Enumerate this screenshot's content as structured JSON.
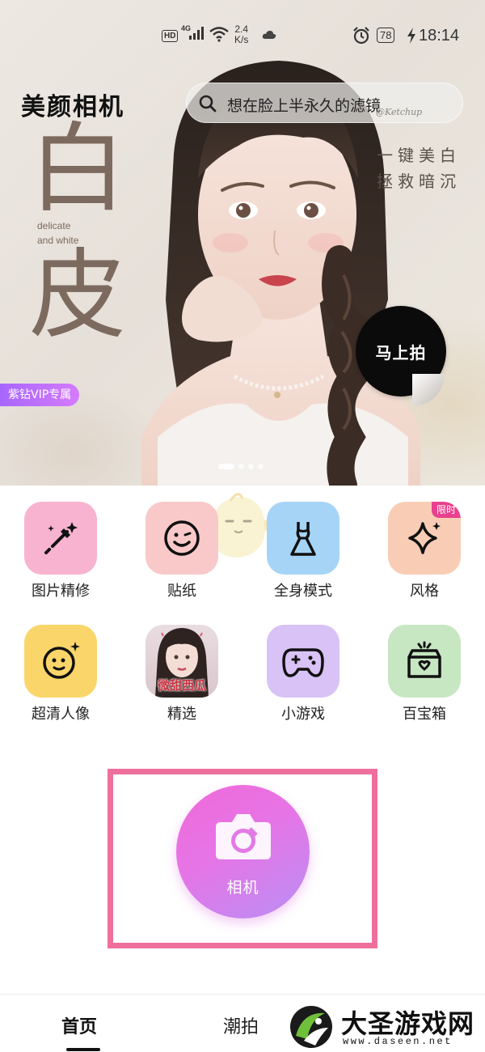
{
  "status_bar": {
    "hd": "HD",
    "network": "4G",
    "speed_value": "2.4",
    "speed_unit": "K/s",
    "battery": "78",
    "time": "18:14"
  },
  "banner": {
    "app_title": "美颜相机",
    "search_placeholder": "想在脸上半永久的滤镜",
    "watermark": "@Ketchup",
    "big_char_1": "白",
    "big_char_2": "皮",
    "subtitle_en_1": "delicate",
    "subtitle_en_2": "and white",
    "slogan_1": "一键美白",
    "slogan_2": "拯救暗沉",
    "shoot_now": "马上拍",
    "vip_badge": "紫钻VIP专属",
    "carousel_pages": 4,
    "carousel_active": 1
  },
  "grid": [
    {
      "label": "图片精修",
      "icon": "magic-wand-icon",
      "color": "#f7b3cf"
    },
    {
      "label": "贴纸",
      "icon": "smiley-sticker-icon",
      "color": "#f9c9c9"
    },
    {
      "label": "全身模式",
      "icon": "dress-icon",
      "color": "#a6d4f7"
    },
    {
      "label": "风格",
      "icon": "sparkle-icon",
      "color": "#f9cdb5",
      "badge": "限时"
    },
    {
      "label": "超清人像",
      "icon": "face-sparkle-icon",
      "color": "#fad66a"
    },
    {
      "label": "精选",
      "icon": "featured-thumbnail",
      "thumb_text": "微甜西瓜"
    },
    {
      "label": "小游戏",
      "icon": "gamepad-icon",
      "color": "#d9c2f5"
    },
    {
      "label": "百宝箱",
      "icon": "treasure-box-icon",
      "color": "#c7e6c2"
    }
  ],
  "camera": {
    "label": "相机"
  },
  "bottom_nav": {
    "home": "首页",
    "trend": "潮拍"
  },
  "site_watermark": {
    "name": "大圣游戏网",
    "url": "www.daseen.net"
  },
  "colors": {
    "accent_pink": "#ef6f9c",
    "vip_purple": "#a866ff",
    "camera_gradient_start": "#f06ad9",
    "camera_gradient_end": "#b98ff5"
  }
}
